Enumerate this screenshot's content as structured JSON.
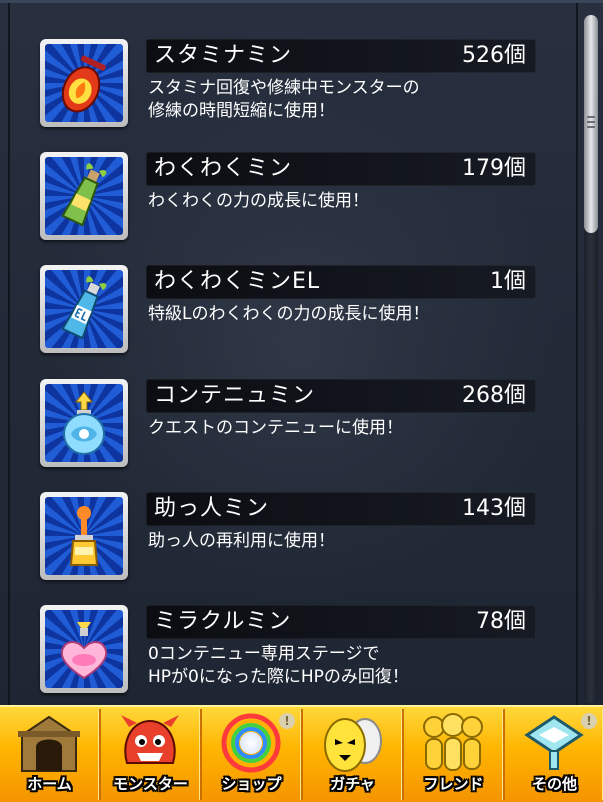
{
  "items": [
    {
      "name": "スタミナミン",
      "count": "526個",
      "desc": "スタミナ回復や修練中モンスターの\n修練の時間短縮に使用！",
      "icon": "stamina-potion-icon"
    },
    {
      "name": "わくわくミン",
      "count": "179個",
      "desc": "わくわくの力の成長に使用！",
      "icon": "green-bottle-icon"
    },
    {
      "name": "わくわくミンEL",
      "count": "1個",
      "desc": "特級Lのわくわくの力の成長に使用！",
      "icon": "el-bottle-icon"
    },
    {
      "name": "コンテニュミン",
      "count": "268個",
      "desc": "クエストのコンテニューに使用！",
      "icon": "continue-orb-icon"
    },
    {
      "name": "助っ人ミン",
      "count": "143個",
      "desc": "助っ人の再利用に使用！",
      "icon": "helper-potion-icon"
    },
    {
      "name": "ミラクルミン",
      "count": "78個",
      "desc": "0コンテニュー専用ステージで\nHPが0になった際にHPのみ回復！",
      "icon": "miracle-heart-icon"
    }
  ],
  "tabs": [
    {
      "label": "ホーム",
      "icon": "home-gate-icon"
    },
    {
      "label": "モンスター",
      "icon": "monster-icon"
    },
    {
      "label": "ショップ",
      "icon": "rainbow-orb-icon"
    },
    {
      "label": "ガチャ",
      "icon": "gacha-egg-icon"
    },
    {
      "label": "フレンド",
      "icon": "friends-icon"
    },
    {
      "label": "その他",
      "icon": "others-icon"
    }
  ],
  "colors": {
    "tab_bar": "#ffb400",
    "icon_bg": "#1f5cd6",
    "name_bar": "#0b0d12"
  }
}
